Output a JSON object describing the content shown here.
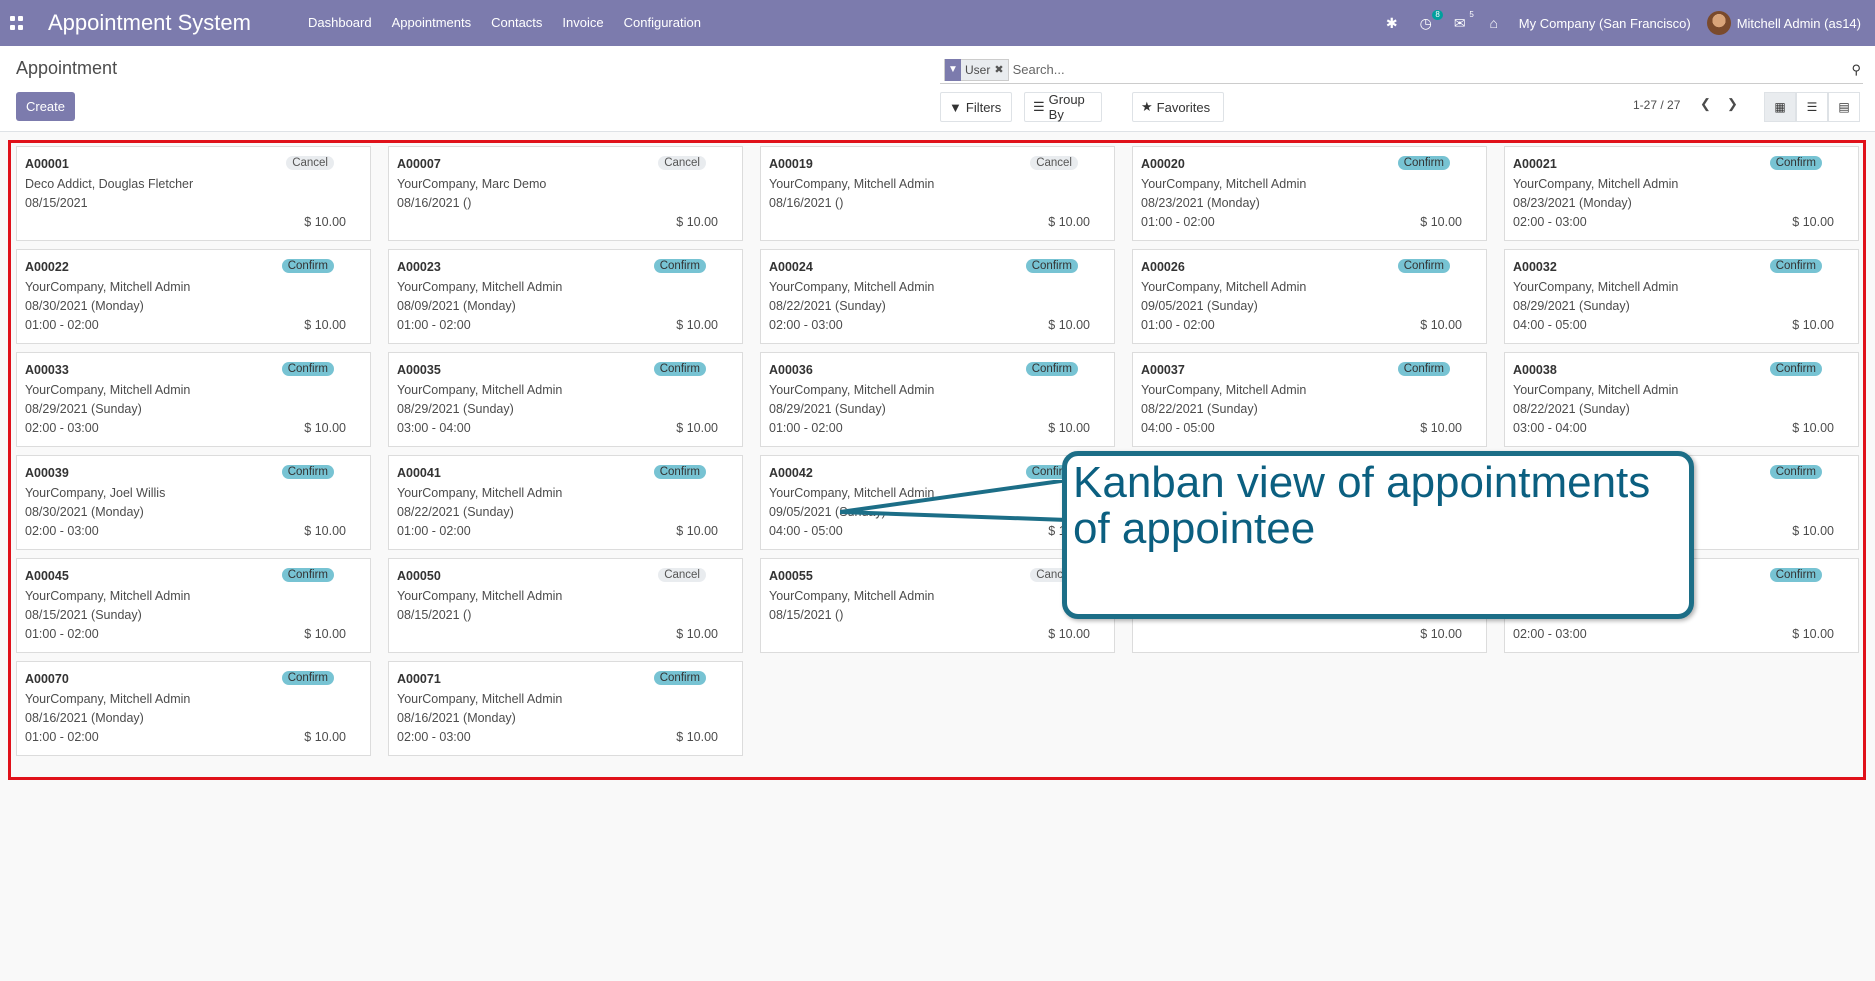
{
  "navbar": {
    "brand": "Appointment System",
    "menu": [
      "Dashboard",
      "Appointments",
      "Contacts",
      "Invoice",
      "Configuration"
    ],
    "activity_badge": "8",
    "messages_badge": "5",
    "company": "My Company (San Francisco)",
    "user": "Mitchell Admin (as14)"
  },
  "control": {
    "breadcrumb": "Appointment",
    "create_label": "Create",
    "facet_value": "User",
    "search_placeholder": "Search...",
    "filters_label": "Filters",
    "group_by_label": "Group By",
    "favorites_label": "Favorites",
    "pager": "1-27 / 27"
  },
  "cards": [
    {
      "ref": "A00001",
      "state": "Cancel",
      "partner": "Deco Addict, Douglas Fletcher",
      "date": "08/15/2021",
      "time": "",
      "amount": "$ 10.00"
    },
    {
      "ref": "A00007",
      "state": "Cancel",
      "partner": "YourCompany, Marc Demo",
      "date": "08/16/2021 ()",
      "time": "",
      "amount": "$ 10.00"
    },
    {
      "ref": "A00019",
      "state": "Cancel",
      "partner": "YourCompany, Mitchell Admin",
      "date": "08/16/2021 ()",
      "time": "",
      "amount": "$ 10.00"
    },
    {
      "ref": "A00020",
      "state": "Confirm",
      "partner": "YourCompany, Mitchell Admin",
      "date": "08/23/2021 (Monday)",
      "time": "01:00 - 02:00",
      "amount": "$ 10.00"
    },
    {
      "ref": "A00021",
      "state": "Confirm",
      "partner": "YourCompany, Mitchell Admin",
      "date": "08/23/2021 (Monday)",
      "time": "02:00 - 03:00",
      "amount": "$ 10.00"
    },
    {
      "ref": "A00022",
      "state": "Confirm",
      "partner": "YourCompany, Mitchell Admin",
      "date": "08/30/2021 (Monday)",
      "time": "01:00 - 02:00",
      "amount": "$ 10.00"
    },
    {
      "ref": "A00023",
      "state": "Confirm",
      "partner": "YourCompany, Mitchell Admin",
      "date": "08/09/2021 (Monday)",
      "time": "01:00 - 02:00",
      "amount": "$ 10.00"
    },
    {
      "ref": "A00024",
      "state": "Confirm",
      "partner": "YourCompany, Mitchell Admin",
      "date": "08/22/2021 (Sunday)",
      "time": "02:00 - 03:00",
      "amount": "$ 10.00"
    },
    {
      "ref": "A00026",
      "state": "Confirm",
      "partner": "YourCompany, Mitchell Admin",
      "date": "09/05/2021 (Sunday)",
      "time": "01:00 - 02:00",
      "amount": "$ 10.00"
    },
    {
      "ref": "A00032",
      "state": "Confirm",
      "partner": "YourCompany, Mitchell Admin",
      "date": "08/29/2021 (Sunday)",
      "time": "04:00 - 05:00",
      "amount": "$ 10.00"
    },
    {
      "ref": "A00033",
      "state": "Confirm",
      "partner": "YourCompany, Mitchell Admin",
      "date": "08/29/2021 (Sunday)",
      "time": "02:00 - 03:00",
      "amount": "$ 10.00"
    },
    {
      "ref": "A00035",
      "state": "Confirm",
      "partner": "YourCompany, Mitchell Admin",
      "date": "08/29/2021 (Sunday)",
      "time": "03:00 - 04:00",
      "amount": "$ 10.00"
    },
    {
      "ref": "A00036",
      "state": "Confirm",
      "partner": "YourCompany, Mitchell Admin",
      "date": "08/29/2021 (Sunday)",
      "time": "01:00 - 02:00",
      "amount": "$ 10.00"
    },
    {
      "ref": "A00037",
      "state": "Confirm",
      "partner": "YourCompany, Mitchell Admin",
      "date": "08/22/2021 (Sunday)",
      "time": "04:00 - 05:00",
      "amount": "$ 10.00"
    },
    {
      "ref": "A00038",
      "state": "Confirm",
      "partner": "YourCompany, Mitchell Admin",
      "date": "08/22/2021 (Sunday)",
      "time": "03:00 - 04:00",
      "amount": "$ 10.00"
    },
    {
      "ref": "A00039",
      "state": "Confirm",
      "partner": "YourCompany, Joel Willis",
      "date": "08/30/2021 (Monday)",
      "time": "02:00 - 03:00",
      "amount": "$ 10.00"
    },
    {
      "ref": "A00041",
      "state": "Confirm",
      "partner": "YourCompany, Mitchell Admin",
      "date": "08/22/2021 (Sunday)",
      "time": "01:00 - 02:00",
      "amount": "$ 10.00"
    },
    {
      "ref": "A00042",
      "state": "Confirm",
      "partner": "YourCompany, Mitchell Admin",
      "date": "09/05/2021 (Sunday)",
      "time": "04:00 - 05:00",
      "amount": "$ 10.00"
    },
    {
      "ref": "",
      "state": "",
      "partner": "",
      "date": "",
      "time": "",
      "amount": ""
    },
    {
      "ref": "",
      "state": "Confirm",
      "partner": "",
      "date": "",
      "time": "",
      "amount": "$ 10.00"
    },
    {
      "ref": "A00045",
      "state": "Confirm",
      "partner": "YourCompany, Mitchell Admin",
      "date": "08/15/2021 (Sunday)",
      "time": "01:00 - 02:00",
      "amount": "$ 10.00"
    },
    {
      "ref": "A00050",
      "state": "Cancel",
      "partner": "YourCompany, Mitchell Admin",
      "date": "08/15/2021 ()",
      "time": "",
      "amount": "$ 10.00"
    },
    {
      "ref": "A00055",
      "state": "Cancel",
      "partner": "YourCompany, Mitchell Admin",
      "date": "08/15/2021 ()",
      "time": "",
      "amount": "$ 10.00"
    },
    {
      "ref": "",
      "state": "",
      "partner": "",
      "date": "",
      "time": "",
      "amount": "$ 10.00"
    },
    {
      "ref": "",
      "state": "Confirm",
      "partner": "",
      "date": "",
      "time": "02:00 - 03:00",
      "amount": "$ 10.00"
    },
    {
      "ref": "A00070",
      "state": "Confirm",
      "partner": "YourCompany, Mitchell Admin",
      "date": "08/16/2021 (Monday)",
      "time": "01:00 - 02:00",
      "amount": "$ 10.00"
    },
    {
      "ref": "A00071",
      "state": "Confirm",
      "partner": "YourCompany, Mitchell Admin",
      "date": "08/16/2021 (Monday)",
      "time": "02:00 - 03:00",
      "amount": "$ 10.00"
    }
  ],
  "callout": {
    "text": "Kanban view of appointments of appointee"
  }
}
